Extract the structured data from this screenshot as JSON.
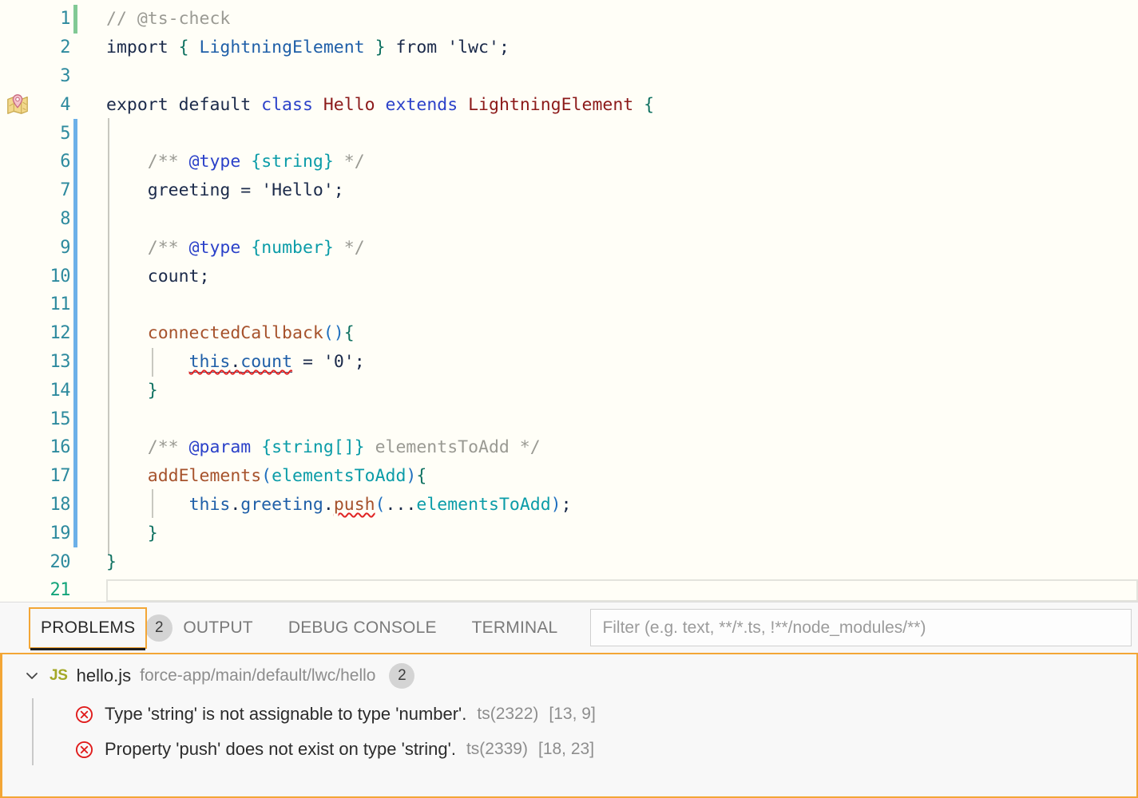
{
  "editor": {
    "language": "javascript",
    "background": "#FFFEF7",
    "gutter_icon": "map-marker-icon",
    "lines": [
      {
        "n": 1,
        "diff": "added",
        "active": false
      },
      {
        "n": 2,
        "diff": "none",
        "active": false
      },
      {
        "n": 3,
        "diff": "none",
        "active": false
      },
      {
        "n": 4,
        "diff": "none",
        "active": false
      },
      {
        "n": 5,
        "diff": "modified",
        "active": false
      },
      {
        "n": 6,
        "diff": "modified",
        "active": false
      },
      {
        "n": 7,
        "diff": "modified",
        "active": false
      },
      {
        "n": 8,
        "diff": "modified",
        "active": false
      },
      {
        "n": 9,
        "diff": "modified",
        "active": false
      },
      {
        "n": 10,
        "diff": "modified",
        "active": false
      },
      {
        "n": 11,
        "diff": "modified",
        "active": false
      },
      {
        "n": 12,
        "diff": "modified",
        "active": false
      },
      {
        "n": 13,
        "diff": "modified",
        "active": false
      },
      {
        "n": 14,
        "diff": "modified",
        "active": false
      },
      {
        "n": 15,
        "diff": "modified",
        "active": false
      },
      {
        "n": 16,
        "diff": "modified",
        "active": false
      },
      {
        "n": 17,
        "diff": "modified",
        "active": false
      },
      {
        "n": 18,
        "diff": "modified",
        "active": false
      },
      {
        "n": 19,
        "diff": "modified",
        "active": false
      },
      {
        "n": 20,
        "diff": "none",
        "active": false
      },
      {
        "n": 21,
        "diff": "none",
        "active": true
      }
    ],
    "source_text": [
      "// @ts-check",
      "import { LightningElement } from 'lwc';",
      "",
      "export default class Hello extends LightningElement {",
      "",
      "    /** @type {string} */",
      "    greeting = 'Hello';",
      "",
      "    /** @type {number} */",
      "    count;",
      "",
      "    connectedCallback(){",
      "        this.count = '0';",
      "    }",
      "",
      "    /** @param {string[]} elementsToAdd */",
      "    addElements(elementsToAdd){",
      "        this.greeting.push(...elementsToAdd);",
      "    }",
      "}",
      ""
    ]
  },
  "panel": {
    "tabs": [
      {
        "id": "problems",
        "label": "PROBLEMS",
        "badge": "2",
        "active": true
      },
      {
        "id": "output",
        "label": "OUTPUT",
        "badge": null,
        "active": false
      },
      {
        "id": "debug-console",
        "label": "DEBUG CONSOLE",
        "badge": null,
        "active": false
      },
      {
        "id": "terminal",
        "label": "TERMINAL",
        "badge": null,
        "active": false
      }
    ],
    "filter": {
      "value": "",
      "placeholder": "Filter (e.g. text, **/*.ts, !**/node_modules/**)"
    },
    "focus_color": "#f3a636",
    "problems": {
      "file": {
        "icon": "js-file-icon",
        "icon_label": "JS",
        "name": "hello.js",
        "path": "force-app/main/default/lwc/hello",
        "count": "2",
        "expanded": true,
        "chevron": "chevron-down-icon"
      },
      "items": [
        {
          "severity": "error",
          "icon": "error-circle-x-icon",
          "message": "Type 'string' is not assignable to type 'number'.",
          "code": "ts(2322)",
          "position": "[13, 9]"
        },
        {
          "severity": "error",
          "icon": "error-circle-x-icon",
          "message": "Property 'push' does not exist on type 'string'.",
          "code": "ts(2339)",
          "position": "[18, 23]"
        }
      ]
    }
  }
}
